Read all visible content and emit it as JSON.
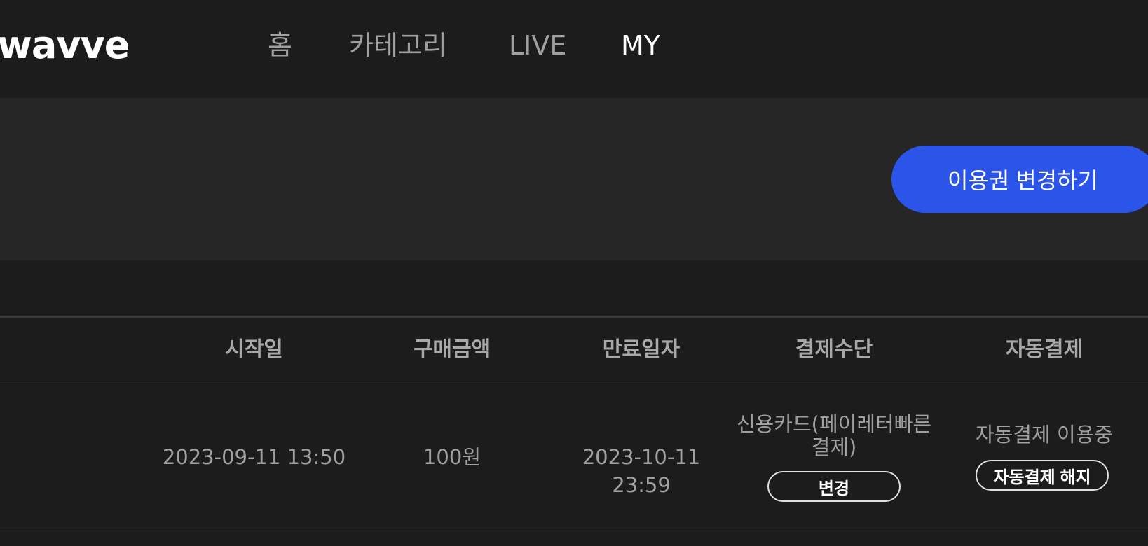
{
  "header": {
    "logo": "wavve",
    "nav": [
      {
        "label": "홈"
      },
      {
        "label": "카테고리"
      },
      {
        "label": "LIVE"
      },
      {
        "label": "MY"
      }
    ]
  },
  "banner": {
    "change_plan_label": "이용권 변경하기"
  },
  "table": {
    "columns": [
      "시작일",
      "구매금액",
      "만료일자",
      "결제수단",
      "자동결제"
    ],
    "row": {
      "start_date": "2023-09-11 13:50",
      "amount": "100원",
      "expiry_date": "2023-10-11 23:59",
      "payment_method_line1": "신용카드(페이레터빠른",
      "payment_method_line2": "결제)",
      "change_button": "변경",
      "auto_pay_status": "자동결제 이용중",
      "cancel_auto_pay_button": "자동결제 해지"
    }
  },
  "colors": {
    "background": "#1c1c1c",
    "banner": "#262626",
    "accent": "#2a55e8"
  }
}
